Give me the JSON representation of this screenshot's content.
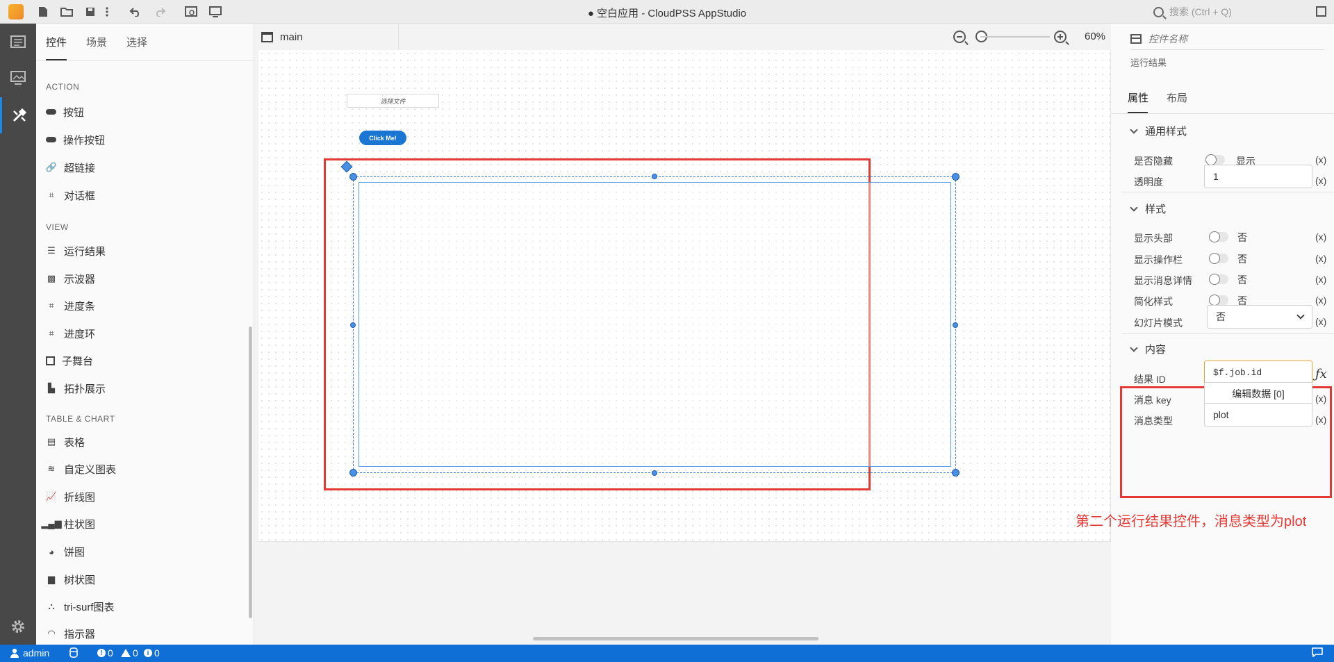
{
  "window": {
    "title": "● 空白应用 - CloudPSS AppStudio",
    "search_placeholder": "搜索 (Ctrl + Q)"
  },
  "comp_panel": {
    "tabs": [
      "控件",
      "场景",
      "选择"
    ],
    "sections": [
      {
        "title": "ACTION",
        "items": [
          "按钮",
          "操作按钮",
          "超链接",
          "对话框"
        ]
      },
      {
        "title": "VIEW",
        "items": [
          "运行结果",
          "示波器",
          "进度条",
          "进度环",
          "子舞台",
          "拓扑展示"
        ]
      },
      {
        "title": "TABLE & CHART",
        "items": [
          "表格",
          "自定义图表",
          "折线图",
          "柱状图",
          "饼图",
          "树状图",
          "tri-surf图表",
          "指示器"
        ]
      }
    ]
  },
  "canvas": {
    "tab_label": "main",
    "zoom": "60%",
    "file_select_label": "选择文件",
    "click_button_label": "Click Me!"
  },
  "props": {
    "name_placeholder": "控件名称",
    "control_type": "运行结果",
    "tabs": [
      "属性",
      "布局"
    ],
    "groups": {
      "general": {
        "title": "通用样式",
        "hidden_label": "是否隐藏",
        "hidden_value": "显示",
        "opacity_label": "透明度",
        "opacity_value": "1"
      },
      "style": {
        "title": "样式",
        "show_header_label": "显示头部",
        "show_header_value": "否",
        "show_toolbar_label": "显示操作栏",
        "show_toolbar_value": "否",
        "show_detail_label": "显示消息详情",
        "show_detail_value": "否",
        "simplified_label": "简化样式",
        "simplified_value": "否",
        "slideshow_label": "幻灯片模式",
        "slideshow_value": "否"
      },
      "content": {
        "title": "内容",
        "result_id_label": "结果 ID",
        "result_id_value": "$f.job.id",
        "message_key_label": "消息 key",
        "message_key_value": "编辑数据 [0]",
        "message_type_label": "消息类型",
        "message_type_value": "plot"
      }
    },
    "x_label": "(x)",
    "fx_label": "ƒx"
  },
  "annotation": "第二个运行结果控件，消息类型为plot",
  "statusbar": {
    "user": "admin",
    "errors": "0",
    "warnings": "0",
    "infos": "0"
  },
  "colors": {
    "accent": "#1e88e5",
    "statusbar": "#0f6fd6",
    "highlight": "#e53935"
  }
}
